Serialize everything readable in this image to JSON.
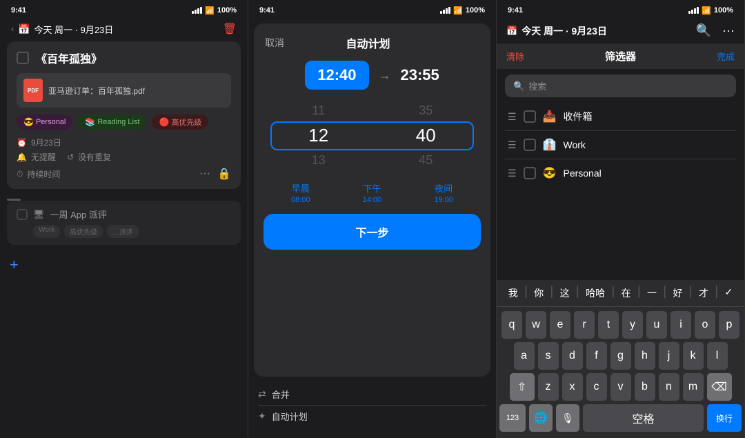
{
  "panels": {
    "panel1": {
      "statusBar": {
        "time": "9:41",
        "battery": "100%",
        "signal": "●●●●"
      },
      "header": {
        "chevron": "›",
        "icon": "📅",
        "title": "今天 周一 · 9月23日",
        "trashIcon": "🗑"
      },
      "taskCard": {
        "checkbox": "",
        "title": "《百年孤独》",
        "attachment": {
          "pdfLabel": "PDF",
          "name": "亚马逊订单：百年孤独.pdf"
        },
        "tags": [
          {
            "emoji": "😎",
            "label": "Personal",
            "type": "personal"
          },
          {
            "emoji": "📚",
            "label": "Reading List",
            "type": "reading"
          },
          {
            "emoji": "🔴",
            "label": "高优先级",
            "type": "priority"
          }
        ],
        "date": "9月23日",
        "reminder": "无提醒",
        "repeat": "没有重复",
        "duration": "持续时间",
        "dotsIcon": "···",
        "lockIcon": "🔒"
      },
      "miniTask": {
        "title": "一周 App 派评",
        "tags": [
          "Work",
          "高优先级",
          "…派评"
        ]
      },
      "addButton": "+"
    },
    "panel2": {
      "statusBar": {
        "time": "9:41",
        "battery": "100%"
      },
      "header": {
        "cancel": "取消",
        "title": "自动计划",
        "empty": ""
      },
      "timeRange": {
        "start": "12:40",
        "arrow": "→",
        "end": "23:55"
      },
      "picker": {
        "hourAbove": "11",
        "hourSelected": "12",
        "hourBelow": "13",
        "minuteAbove": "35",
        "minuteSelected": "40",
        "minuteBelow": "45"
      },
      "presets": [
        {
          "label": "早晨",
          "time": "08:00"
        },
        {
          "label": "下午",
          "time": "14:00"
        },
        {
          "label": "夜间",
          "time": "19:00"
        }
      ],
      "nextButton": "下一步",
      "bottomItems": [
        {
          "icon": "⇄",
          "label": "合并"
        },
        {
          "icon": "✦",
          "label": "自动计划"
        }
      ]
    },
    "panel3": {
      "statusBar": {
        "time": "9:41",
        "battery": "100%"
      },
      "header": {
        "calIcon": "📅",
        "title": "今天 周一 · 9月23日",
        "searchIcon": "🔍",
        "moreIcon": "···"
      },
      "filterBar": {
        "clear": "清除",
        "title": "筛选器",
        "done": "完成"
      },
      "searchPlaceholder": "搜索",
      "filterItems": [
        {
          "icon": "☰",
          "label": "收件箱",
          "emoji": "📥"
        },
        {
          "icon": "☰",
          "label": "Work",
          "emoji": "👔"
        },
        {
          "icon": "☰",
          "label": "Personal",
          "emoji": "😎"
        }
      ],
      "suggestions": [
        "我",
        "你",
        "这",
        "哈哈",
        "在",
        "一",
        "好",
        "才",
        "✓"
      ],
      "keyboard": {
        "row1": [
          "q",
          "w",
          "e",
          "r",
          "t",
          "y",
          "u",
          "i",
          "o",
          "p"
        ],
        "row2": [
          "a",
          "s",
          "d",
          "f",
          "g",
          "h",
          "j",
          "k",
          "l"
        ],
        "row3": [
          "z",
          "x",
          "c",
          "v",
          "b",
          "n",
          "m"
        ],
        "bottomLeft": "123",
        "bottomGlobe": "🌐",
        "bottomMic": "🎙",
        "space": "空格",
        "enter": "换行",
        "shift": "⇧",
        "delete": "⌫"
      }
    }
  }
}
